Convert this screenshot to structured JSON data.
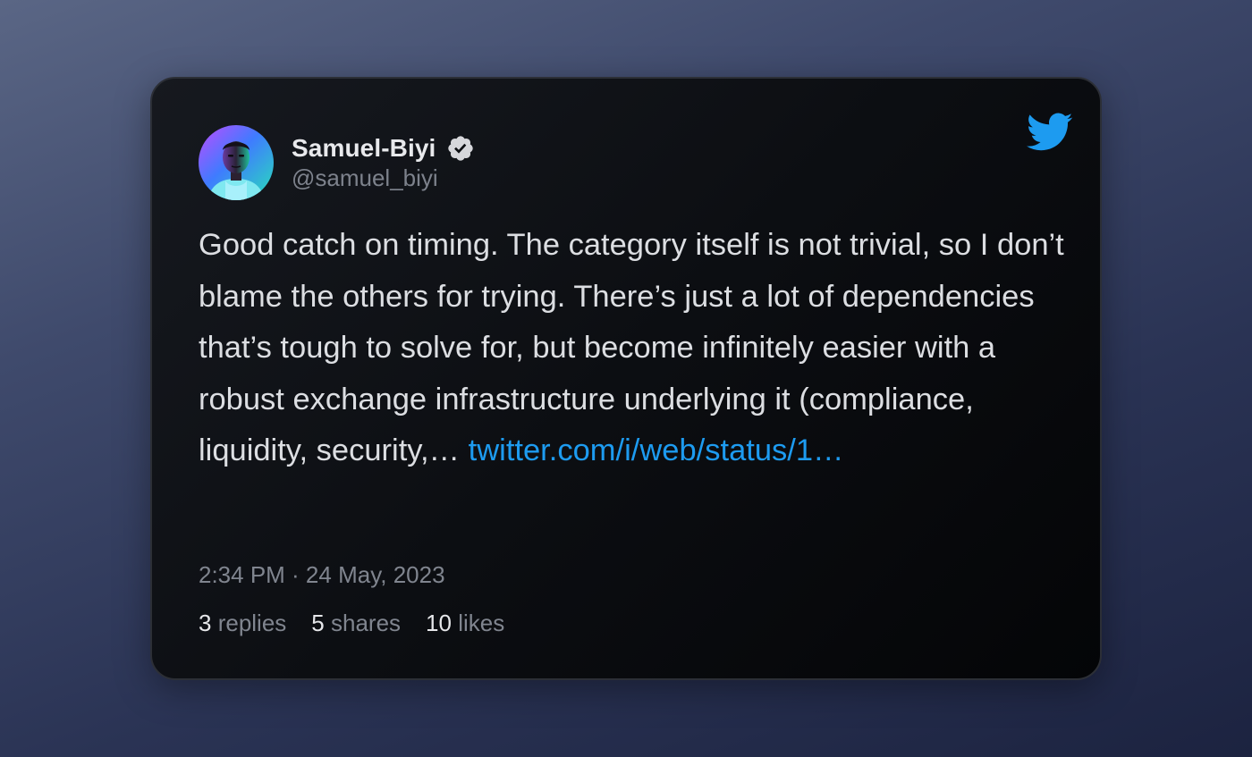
{
  "author": {
    "display_name": "Samuel-Biyi",
    "handle": "@samuel_biyi",
    "verified": true,
    "avatar_icon": "profile-photo"
  },
  "tweet": {
    "text": "Good catch on timing. The category itself is not trivial, so I don’t blame the others for trying. There’s just a lot of dependencies that’s tough to solve for, but become infinitely easier with a robust exchange infrastructure underlying it (compliance, liquidity, security,…",
    "link_text": "twitter.com/i/web/status/1…",
    "timestamp": "2:34 PM · 24 May, 2023"
  },
  "stats": {
    "replies_count": "3",
    "replies_label": "replies",
    "shares_count": "5",
    "shares_label": "shares",
    "likes_count": "10",
    "likes_label": "likes"
  },
  "colors": {
    "twitter_blue": "#1d9bf0",
    "card_background": "#0c0e12",
    "text_primary": "#dcdee2",
    "text_secondary": "#80858f"
  },
  "icons": {
    "brand": "twitter-bird-icon",
    "verified": "verified-badge-icon"
  }
}
